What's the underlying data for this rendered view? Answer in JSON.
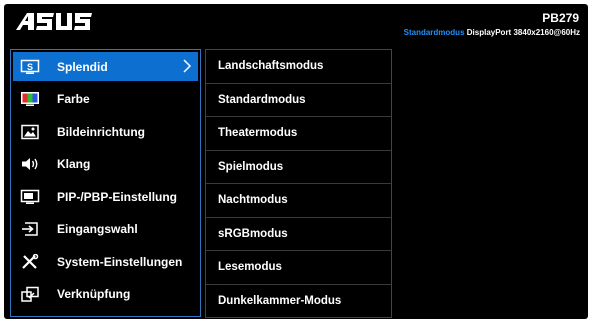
{
  "header": {
    "logo_text": "ASUS",
    "model": "PB279",
    "status": {
      "mode": "Standardmodus",
      "input": "DisplayPort",
      "resolution": "3840x2160@60Hz"
    }
  },
  "main_menu": {
    "items": [
      {
        "label": "Splendid",
        "icon": "splendid-icon",
        "active": true
      },
      {
        "label": "Farbe",
        "icon": "color-icon"
      },
      {
        "label": "Bildeinrichtung",
        "icon": "image-icon"
      },
      {
        "label": "Klang",
        "icon": "speaker-icon"
      },
      {
        "label": "PIP-/PBP-Einstellung",
        "icon": "pip-icon"
      },
      {
        "label": "Eingangswahl",
        "icon": "input-icon"
      },
      {
        "label": "System-Einstellungen",
        "icon": "tools-icon"
      },
      {
        "label": "Verknüpfung",
        "icon": "shortcut-icon"
      }
    ]
  },
  "sub_menu": {
    "items": [
      {
        "label": "Landschaftsmodus"
      },
      {
        "label": "Standardmodus"
      },
      {
        "label": "Theatermodus"
      },
      {
        "label": "Spielmodus"
      },
      {
        "label": "Nachtmodus"
      },
      {
        "label": "sRGBmodus"
      },
      {
        "label": "Lesemodus"
      },
      {
        "label": "Dunkelkammer-Modus"
      }
    ]
  },
  "colors": {
    "accent": "#0d6fd0",
    "status_mode": "#1e90ff",
    "menu_border": "#2f74c0",
    "background": "#000000"
  }
}
